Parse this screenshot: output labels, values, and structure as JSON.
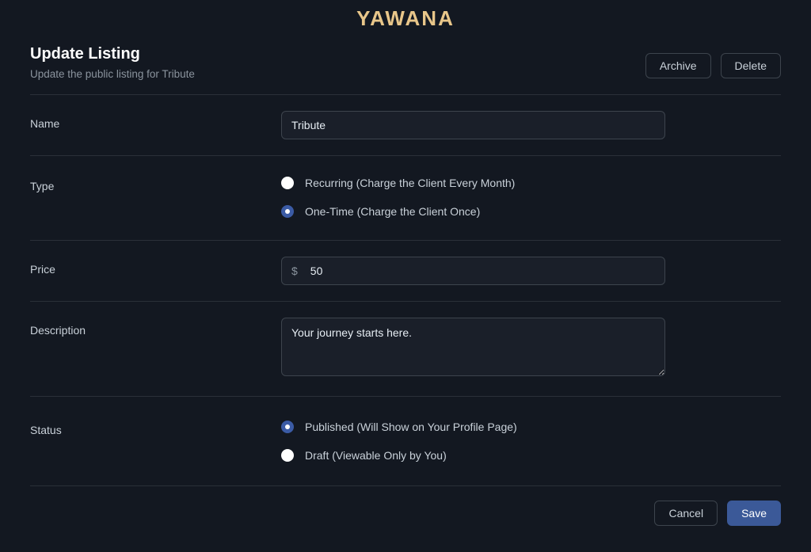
{
  "logo": "YAWANA",
  "header": {
    "title": "Update Listing",
    "subtitle": "Update the public listing for Tribute",
    "archive_label": "Archive",
    "delete_label": "Delete"
  },
  "fields": {
    "name": {
      "label": "Name",
      "value": "Tribute"
    },
    "type": {
      "label": "Type",
      "options": {
        "recurring": "Recurring (Charge the Client Every Month)",
        "one_time": "One-Time (Charge the Client Once)"
      },
      "selected": "one_time"
    },
    "price": {
      "label": "Price",
      "prefix": "$",
      "value": "50"
    },
    "description": {
      "label": "Description",
      "value": "Your journey starts here."
    },
    "status": {
      "label": "Status",
      "options": {
        "published": "Published (Will Show on Your Profile Page)",
        "draft": "Draft (Viewable Only by You)"
      },
      "selected": "published"
    }
  },
  "footer": {
    "cancel_label": "Cancel",
    "save_label": "Save"
  }
}
